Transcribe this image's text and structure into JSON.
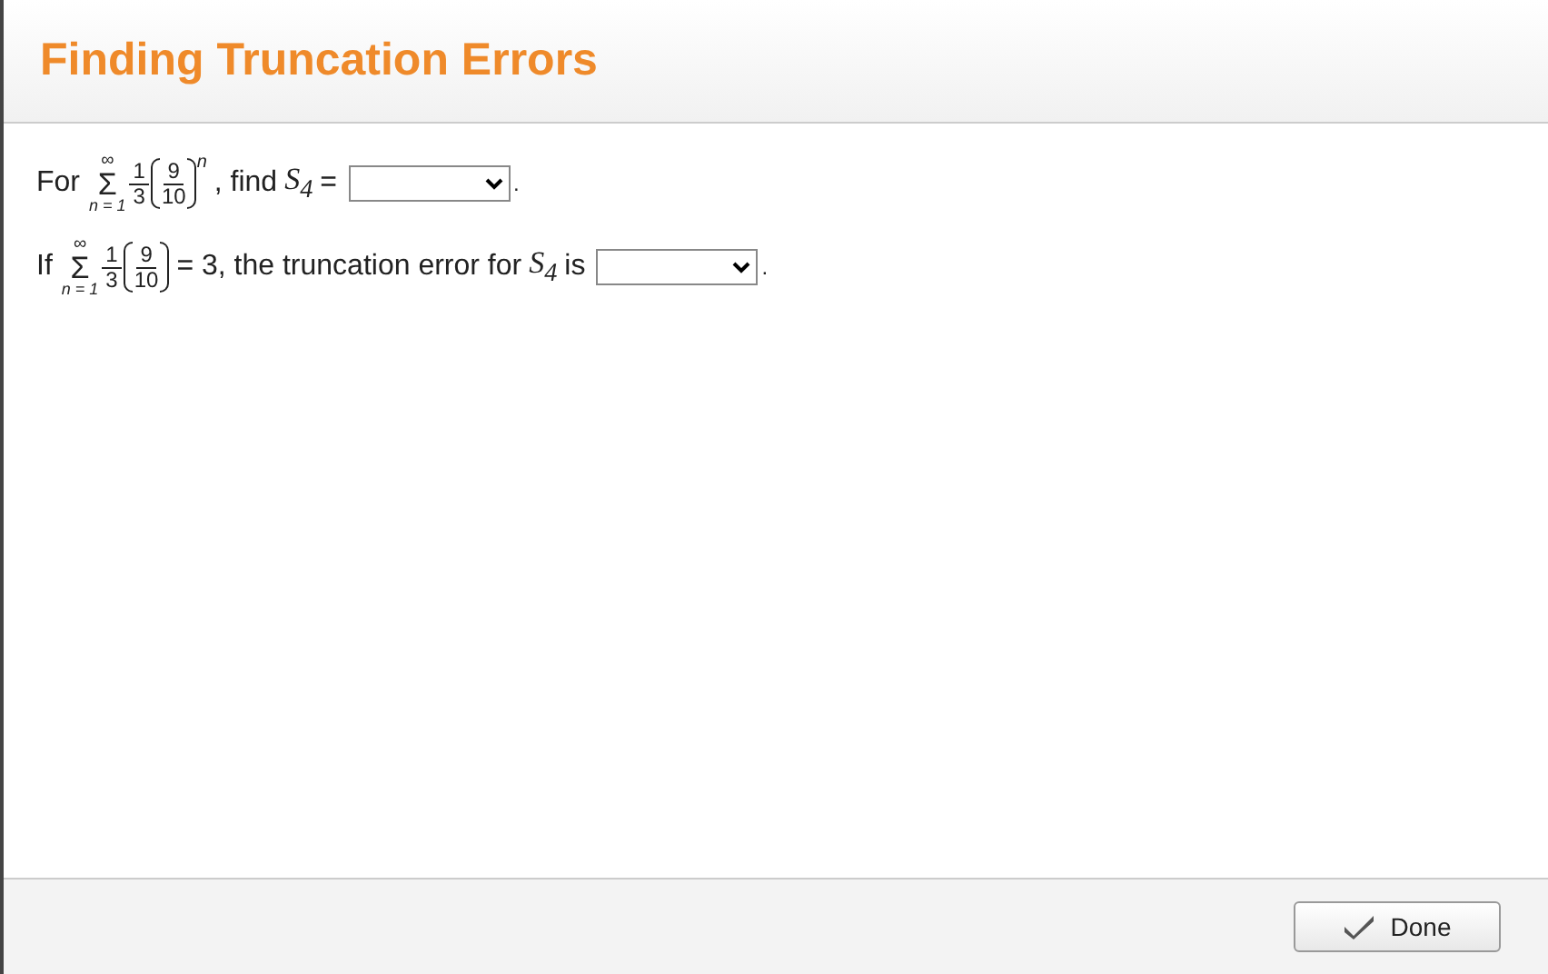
{
  "title": "Finding Truncation Errors",
  "questions": [
    {
      "lead": "For",
      "sum_upper": "∞",
      "sum_symbol": "Σ",
      "sum_lower": "n = 1",
      "coef_num": "1",
      "coef_den": "3",
      "base_num": "9",
      "base_den": "10",
      "exponent": "n",
      "before_term": ", find",
      "term": "S$_{4}$",
      "after_term": "=",
      "end": "."
    },
    {
      "lead": "If",
      "sum_upper": "∞",
      "sum_symbol": "Σ",
      "sum_lower": "n = 1",
      "coef_num": "1",
      "coef_den": "3",
      "base_num": "9",
      "base_den": "10",
      "before_term": "= 3, the truncation error for",
      "term": "S$_{4}$",
      "after_term": "is",
      "end": "."
    }
  ],
  "done_button": "Done"
}
